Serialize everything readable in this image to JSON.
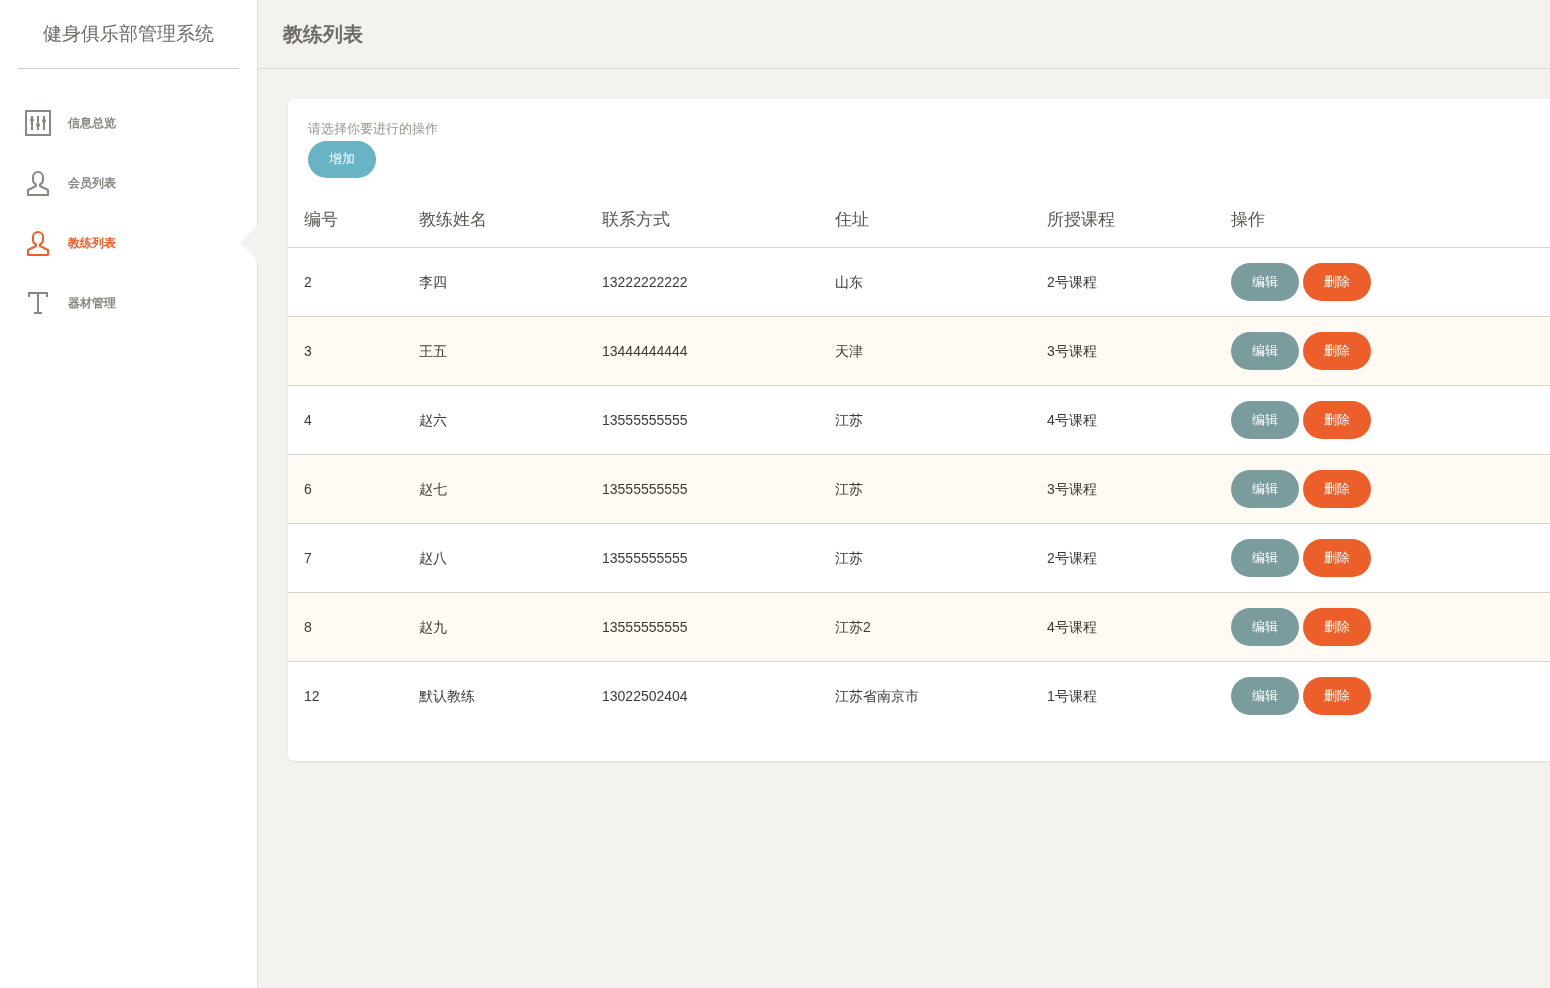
{
  "sidebar": {
    "title": "健身俱乐部管理系统",
    "items": [
      {
        "label": "信息总览",
        "selected": false
      },
      {
        "label": "会员列表",
        "selected": false
      },
      {
        "label": "教练列表",
        "selected": true
      },
      {
        "label": "器材管理",
        "selected": false
      }
    ]
  },
  "header": {
    "title": "教练列表"
  },
  "toolbar": {
    "hint": "请选择你要进行的操作",
    "add_button": "增加"
  },
  "table": {
    "columns": [
      "编号",
      "教练姓名",
      "联系方式",
      "住址",
      "所授课程",
      "操作"
    ],
    "rows": [
      {
        "cells": [
          "2",
          "李四",
          "13222222222",
          "山东",
          "2号课程"
        ],
        "actions": [
          "编辑",
          "删除"
        ]
      },
      {
        "cells": [
          "3",
          "王五",
          "13444444444",
          "天津",
          "3号课程"
        ],
        "actions": [
          "编辑",
          "删除"
        ]
      },
      {
        "cells": [
          "4",
          "赵六",
          "13555555555",
          "江苏",
          "4号课程"
        ],
        "actions": [
          "编辑",
          "删除"
        ]
      },
      {
        "cells": [
          "6",
          "赵七",
          "13555555555",
          "江苏",
          "3号课程"
        ],
        "actions": [
          "编辑",
          "删除"
        ]
      },
      {
        "cells": [
          "7",
          "赵八",
          "13555555555",
          "江苏",
          "2号课程"
        ],
        "actions": [
          "编辑",
          "删除"
        ]
      },
      {
        "cells": [
          "8",
          "赵九",
          "13555555555",
          "江苏2",
          "4号课程"
        ],
        "actions": [
          "编辑",
          "删除"
        ]
      },
      {
        "cells": [
          "12",
          "默认教练",
          "13022502404",
          "江苏省南京市",
          "1号课程"
        ],
        "actions": [
          "编辑",
          "删除"
        ]
      }
    ]
  }
}
